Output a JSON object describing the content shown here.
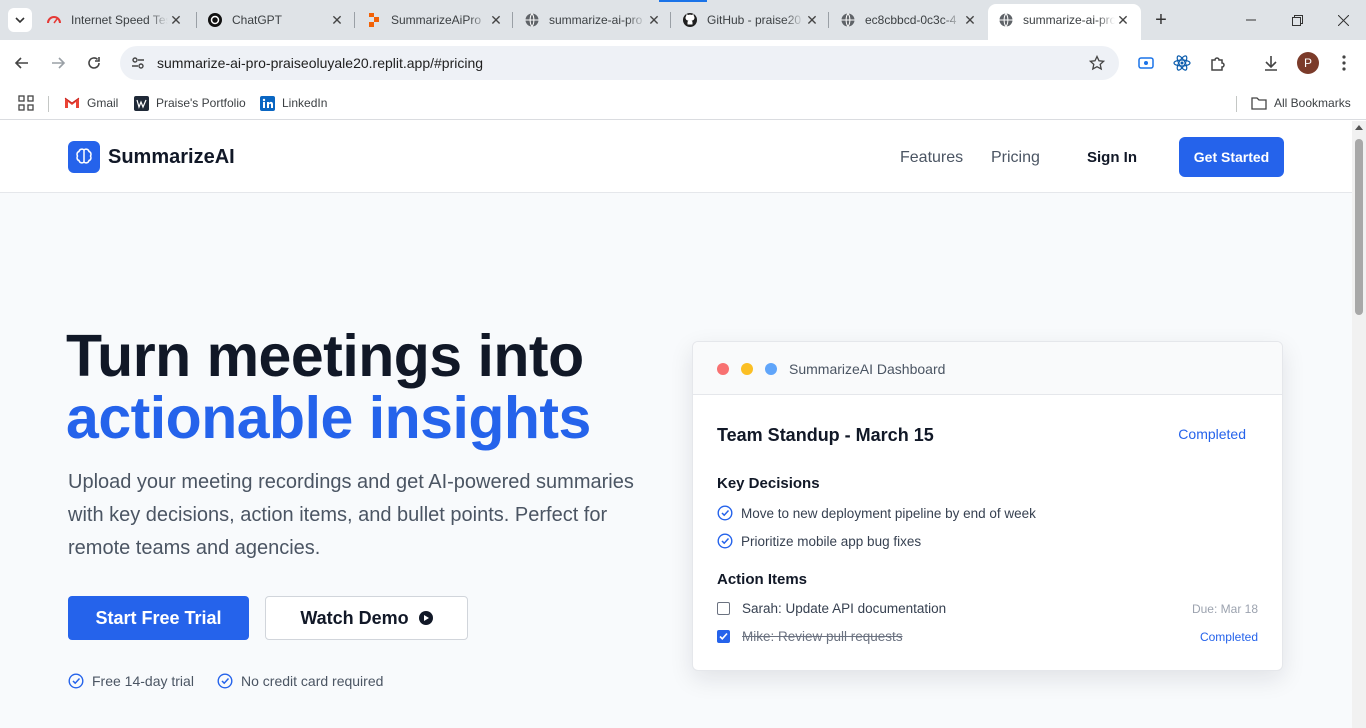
{
  "browser": {
    "tabs": [
      {
        "title": "Internet Speed Test | Fast",
        "favicon": "speedometer-icon",
        "active": false
      },
      {
        "title": "ChatGPT",
        "favicon": "openai-icon",
        "active": false
      },
      {
        "title": "SummarizeAiPro",
        "favicon": "replit-icon",
        "active": false
      },
      {
        "title": "summarize-ai-pro",
        "favicon": "globe-icon",
        "active": false
      },
      {
        "title": "GitHub - praise20",
        "favicon": "github-icon",
        "active": false
      },
      {
        "title": "ec8cbbcd-0c3c-4",
        "favicon": "globe-icon",
        "active": false
      },
      {
        "title": "summarize-ai-pro",
        "favicon": "globe-icon",
        "active": true
      }
    ],
    "url": "summarize-ai-pro-praiseoluyale20.replit.app/#pricing",
    "profile_initial": "P",
    "bookmarks": [
      {
        "label": "Gmail",
        "icon": "gmail-icon"
      },
      {
        "label": "Praise's Portfolio",
        "icon": "portfolio-icon"
      },
      {
        "label": "LinkedIn",
        "icon": "linkedin-icon"
      }
    ],
    "all_bookmarks_label": "All Bookmarks"
  },
  "site": {
    "brand": "SummarizeAI",
    "nav": {
      "features": "Features",
      "pricing": "Pricing",
      "signin": "Sign In",
      "cta": "Get Started"
    },
    "hero": {
      "title_line1": "Turn meetings into",
      "title_line2": "actionable insights",
      "subtitle": "Upload your meeting recordings and get AI-powered summaries with key decisions, action items, and bullet points. Perfect for remote teams and agencies.",
      "primary_cta": "Start Free Trial",
      "secondary_cta": "Watch Demo",
      "perks": [
        "Free 14-day trial",
        "No credit card required"
      ]
    },
    "dashboard": {
      "window_title": "SummarizeAI Dashboard",
      "meeting_title": "Team Standup - March 15",
      "status": "Completed",
      "decisions_heading": "Key Decisions",
      "decisions": [
        "Move to new deployment pipeline by end of week",
        "Prioritize mobile app bug fixes"
      ],
      "actions_heading": "Action Items",
      "actions": [
        {
          "text": "Sarah: Update API documentation",
          "meta": "Due: Mar 18",
          "done": false
        },
        {
          "text": "Mike: Review pull requests",
          "meta": "Completed",
          "done": true
        }
      ]
    }
  },
  "colors": {
    "brand_blue": "#2563eb",
    "dot_red": "#f87171",
    "dot_yellow": "#fbbf24",
    "dot_blue": "#60a5fa"
  }
}
